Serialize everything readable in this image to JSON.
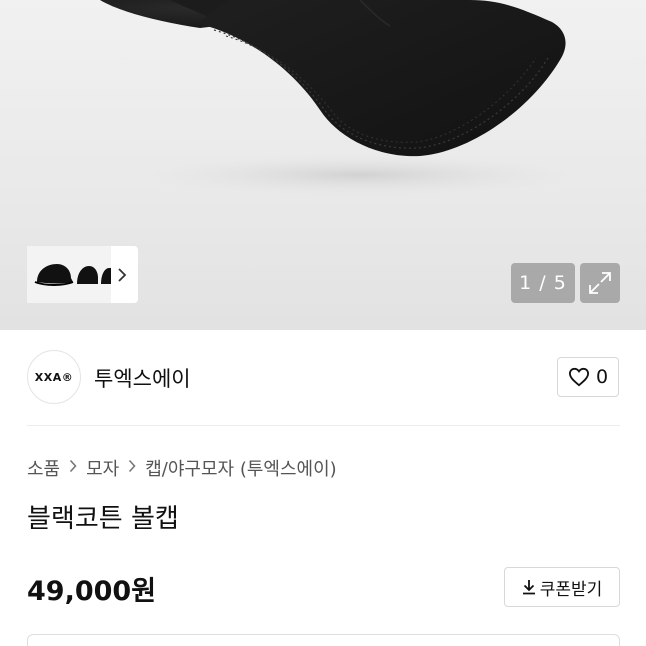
{
  "gallery": {
    "counter_text": "1 / 5",
    "thumbnail_alt": "cap-thumbnails",
    "next_icon": "chevron-right-icon",
    "expand_icon": "expand-icon"
  },
  "brand": {
    "logo_text": "XXA®",
    "name": "투엑스에이",
    "like_count": "0",
    "like_icon": "heart-icon"
  },
  "breadcrumb": {
    "items": [
      "소품",
      "모자",
      "캡/야구모자 (투엑스에이)"
    ]
  },
  "product": {
    "title": "블랙코튼 볼캡",
    "price": "49,000원"
  },
  "coupon": {
    "label": "쿠폰받기",
    "icon": "download-icon"
  },
  "colors": {
    "hero_bg": "#ebebeb",
    "cap": "#1b1b1b",
    "overlay": "#8a8a8a",
    "border": "#d8d8d8"
  }
}
